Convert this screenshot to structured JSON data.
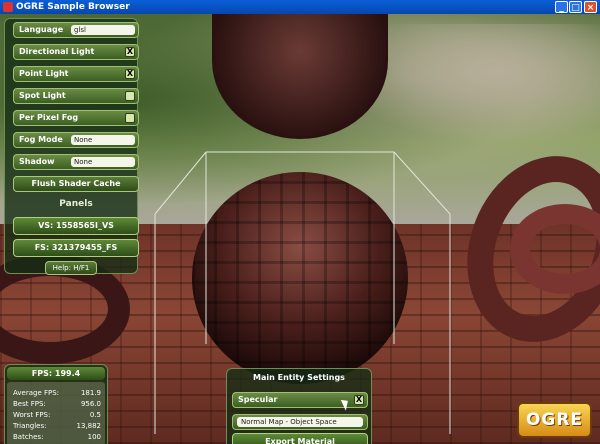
{
  "window": {
    "title": "OGRE Sample Browser",
    "minimize": "_",
    "maximize": "□",
    "close": "×"
  },
  "options_panel": {
    "language": {
      "label": "Language",
      "value": "glsl"
    },
    "directional_light": {
      "label": "Directional Light",
      "checked": true,
      "mark": "X"
    },
    "point_light": {
      "label": "Point Light",
      "checked": true,
      "mark": "X"
    },
    "spot_light": {
      "label": "Spot Light",
      "checked": false,
      "mark": ""
    },
    "per_pixel_fog": {
      "label": "Per Pixel Fog",
      "checked": false,
      "mark": ""
    },
    "fog_mode": {
      "label": "Fog Mode",
      "value": "None"
    },
    "shadow": {
      "label": "Shadow",
      "value": "None"
    },
    "flush_button": "Flush Shader Cache",
    "panels_header": "Panels",
    "vs_button": "VS: 1558565I_VS",
    "fs_button": "FS: 321379455_FS",
    "help_button": "Help: H/F1"
  },
  "stats": {
    "fps_header": "FPS: 199.4",
    "rows": [
      {
        "label": "Average FPS:",
        "value": "181.9"
      },
      {
        "label": "Best FPS:",
        "value": "956.0"
      },
      {
        "label": "Worst FPS:",
        "value": "0.5"
      },
      {
        "label": "Triangles:",
        "value": "13,882"
      },
      {
        "label": "Batches:",
        "value": "100"
      }
    ]
  },
  "entity_panel": {
    "header": "Main Entity Settings",
    "specular": {
      "label": "Specular",
      "checked": true,
      "mark": "X"
    },
    "mapping_value": "Normal Map - Object Space",
    "export_button": "Export Material"
  },
  "logo": {
    "text": "OGRE"
  },
  "colors": {
    "panel_green": "#3c5e23",
    "titlebar_blue": "#0a5fd6"
  }
}
